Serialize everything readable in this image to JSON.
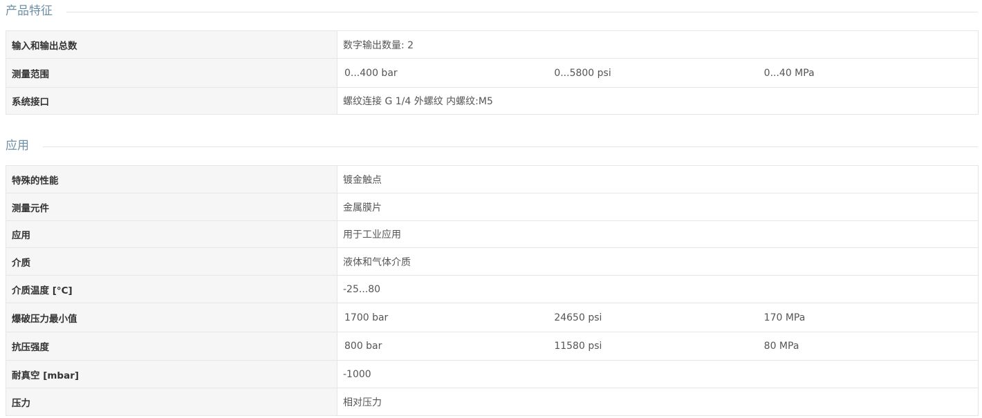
{
  "sections": [
    {
      "title": "产品特征",
      "rows": [
        {
          "label": "输入和输出总数",
          "value": "数字输出数量: 2"
        },
        {
          "label": "测量范围",
          "values": [
            "0...400 bar",
            "0...5800 psi",
            "0...40 MPa"
          ]
        },
        {
          "label": "系统接口",
          "value": "螺纹连接 G 1/4 外螺纹 内螺纹:M5"
        }
      ]
    },
    {
      "title": "应用",
      "rows": [
        {
          "label": "特殊的性能",
          "value": "镀金触点"
        },
        {
          "label": "测量元件",
          "value": "金属膜片"
        },
        {
          "label": "应用",
          "value": "用于工业应用"
        },
        {
          "label": "介质",
          "value": "液体和气体介质"
        },
        {
          "label": "介质温度 [°C]",
          "value": "-25...80"
        },
        {
          "label": "爆破压力最小值",
          "values": [
            "1700 bar",
            "24650 psi",
            "170 MPa"
          ]
        },
        {
          "label": "抗压强度",
          "values": [
            "800 bar",
            "11580 psi",
            "80 MPa"
          ]
        },
        {
          "label": "耐真空 [mbar]",
          "value": "-1000"
        },
        {
          "label": "压力",
          "value": "相对压力"
        }
      ]
    }
  ]
}
